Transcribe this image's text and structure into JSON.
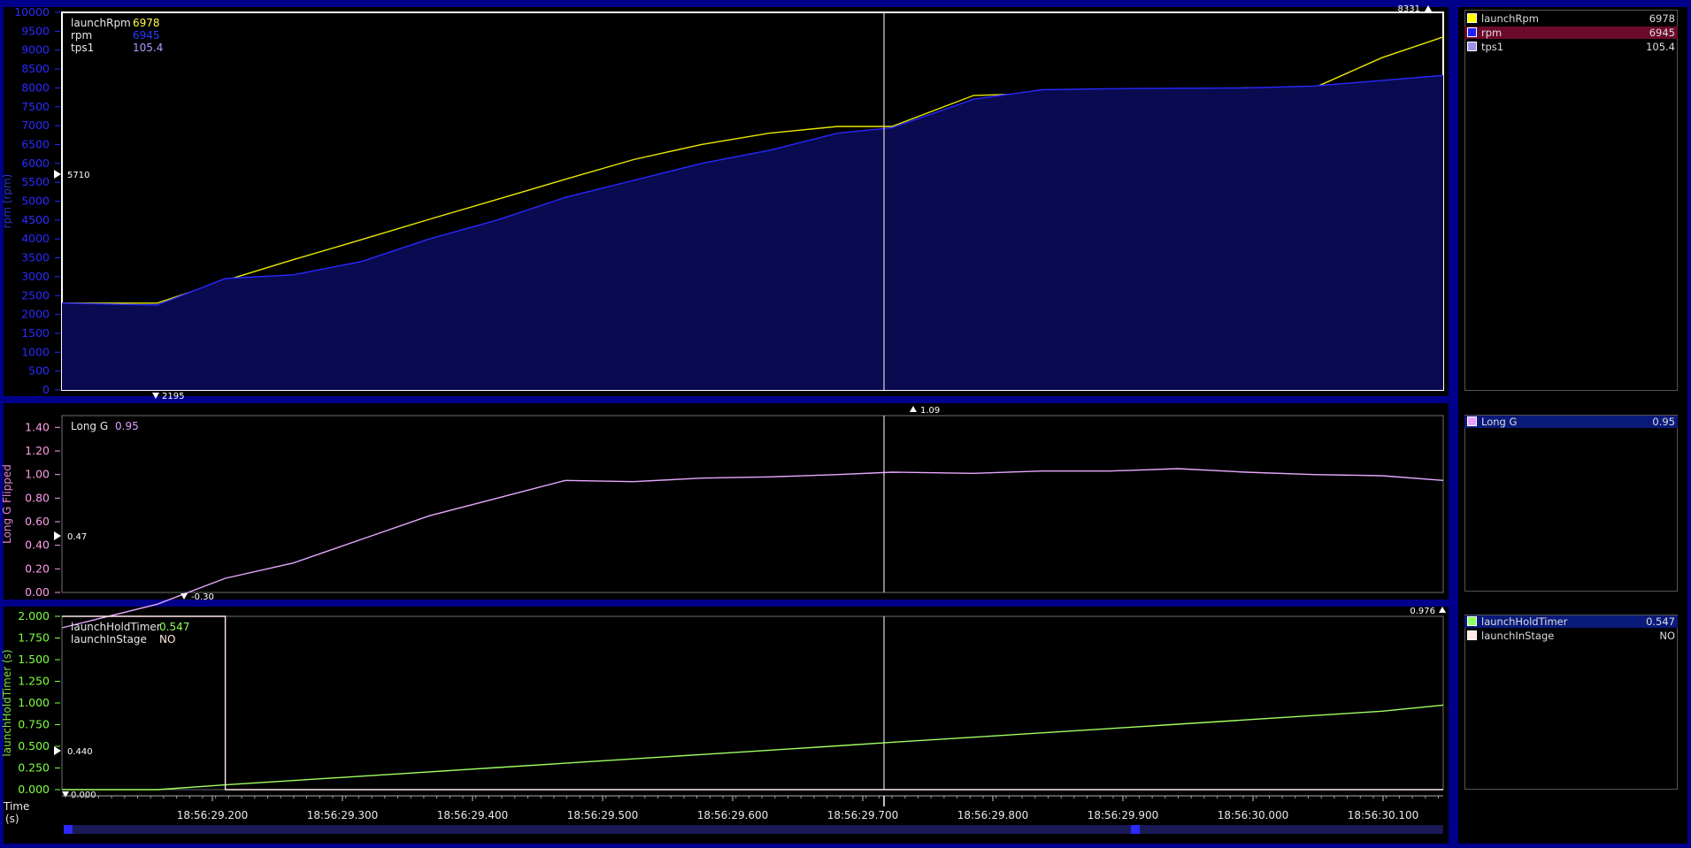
{
  "charts": [
    {
      "name": "rpm-chart",
      "y_axis_label": "rpm (rpm)",
      "ylim": [
        0,
        10000
      ],
      "y_ticks": [
        "0",
        "500",
        "1000",
        "1500",
        "2000",
        "2500",
        "3000",
        "3500",
        "4000",
        "4500",
        "5000",
        "5500",
        "6000",
        "6500",
        "7000",
        "7500",
        "8000",
        "8500",
        "9000",
        "9500",
        "10000"
      ],
      "markers": {
        "max": "8331",
        "min": "2195",
        "left": "5710"
      },
      "readout": [
        {
          "name": "launchRpm",
          "value": "6978",
          "color": "#ffff40"
        },
        {
          "name": "rpm",
          "value": "6945",
          "color": "#2a3aff"
        },
        {
          "name": "tps1",
          "value": "105.4",
          "color": "#a89cff"
        }
      ]
    },
    {
      "name": "long-g-chart",
      "y_axis_label": "Long G Flipped",
      "ylim": [
        0,
        1.5
      ],
      "y_ticks": [
        "0.00",
        "0.20",
        "0.40",
        "0.60",
        "0.80",
        "1.00",
        "1.20",
        "1.40"
      ],
      "markers": {
        "max": "1.09",
        "min": "-0.30",
        "left": "0.47"
      },
      "readout": [
        {
          "name": "Long G",
          "value": "0.95",
          "color": "#e0a0ff"
        }
      ]
    },
    {
      "name": "launch-timer-chart",
      "y_axis_label": "launchHoldTimer (s)",
      "ylim": [
        0,
        2
      ],
      "y_ticks": [
        "0.000",
        "0.250",
        "0.500",
        "0.750",
        "1.000",
        "1.250",
        "1.500",
        "1.750",
        "2.000"
      ],
      "markers": {
        "max": "0.976",
        "min": "0.000",
        "left": "0.440"
      },
      "readout": [
        {
          "name": "launchHoldTimer",
          "value": "0.547",
          "color": "#90ff60"
        },
        {
          "name": "launchInStage",
          "value": "NO",
          "color": "#ffe8e0"
        }
      ]
    }
  ],
  "time_axis": {
    "label_line1": "Time",
    "label_line2": "(s)",
    "ticks": [
      "18:56:29.200",
      "18:56:29.300",
      "18:56:29.400",
      "18:56:29.500",
      "18:56:29.600",
      "18:56:29.700",
      "18:56:29.800",
      "18:56:29.900",
      "18:56:30.000",
      "18:56:30.100"
    ]
  },
  "legend": {
    "panel1": [
      {
        "label": "launchRpm",
        "value": "6978",
        "color": "#ffff00"
      },
      {
        "label": "rpm",
        "value": "6945",
        "color": "#2020ff"
      },
      {
        "label": "tps1",
        "value": "105.4",
        "color": "#a090f0"
      }
    ],
    "panel2": [
      {
        "label": "Long G",
        "value": "0.95",
        "color": "#e8a0ff"
      }
    ],
    "panel3": [
      {
        "label": "launchHoldTimer",
        "value": "0.547",
        "color": "#90ff60"
      },
      {
        "label": "launchInStage",
        "value": "NO",
        "color": "#ffe8e8"
      }
    ]
  },
  "chart_data": [
    {
      "type": "line",
      "title": "",
      "xlabel": "Time (s)",
      "ylabel": "rpm (rpm)",
      "x": [
        29.13,
        29.2,
        29.25,
        29.3,
        29.35,
        29.4,
        29.45,
        29.5,
        29.55,
        29.6,
        29.65,
        29.7,
        29.74,
        29.8,
        29.85,
        29.9,
        29.95,
        30.0,
        30.05,
        30.1,
        30.145
      ],
      "series": [
        {
          "name": "launchRpm",
          "color": "#e8e800",
          "values": [
            2300,
            2300,
            2900,
            3450,
            3980,
            4520,
            5050,
            5580,
            6100,
            6500,
            6800,
            6978,
            6978,
            7800,
            7850,
            7900,
            7950,
            8000,
            8000,
            8800,
            9350
          ]
        },
        {
          "name": "rpm",
          "color": "#2828ff",
          "area": true,
          "values": [
            2300,
            2250,
            2950,
            3050,
            3400,
            4000,
            4500,
            5100,
            5550,
            6000,
            6350,
            6800,
            6945,
            7700,
            7950,
            7980,
            7990,
            8000,
            8050,
            8200,
            8331
          ]
        }
      ],
      "ylim": [
        0,
        10000
      ]
    },
    {
      "type": "line",
      "title": "",
      "xlabel": "Time (s)",
      "ylabel": "Long G Flipped",
      "x": [
        29.13,
        29.2,
        29.25,
        29.3,
        29.35,
        29.4,
        29.45,
        29.5,
        29.55,
        29.6,
        29.65,
        29.7,
        29.74,
        29.8,
        29.85,
        29.9,
        29.95,
        30.0,
        30.05,
        30.1,
        30.145
      ],
      "series": [
        {
          "name": "Long G",
          "color": "#e8a8ff",
          "values": [
            -0.3,
            -0.1,
            0.12,
            0.25,
            0.45,
            0.65,
            0.8,
            0.95,
            0.94,
            0.97,
            0.98,
            1.0,
            1.02,
            1.01,
            1.03,
            1.03,
            1.05,
            1.02,
            1.0,
            0.99,
            0.95
          ]
        }
      ],
      "ylim": [
        0,
        1.5
      ]
    },
    {
      "type": "line",
      "title": "",
      "xlabel": "Time (s)",
      "ylabel": "launchHoldTimer (s)",
      "x": [
        29.13,
        29.2,
        29.25,
        29.3,
        29.35,
        29.4,
        29.45,
        29.5,
        29.55,
        29.6,
        29.65,
        29.7,
        29.74,
        29.8,
        29.85,
        29.9,
        29.95,
        30.0,
        30.05,
        30.1,
        30.145
      ],
      "series": [
        {
          "name": "launchHoldTimer",
          "color": "#a0ff60",
          "values": [
            0.0,
            0.0,
            0.055,
            0.105,
            0.155,
            0.205,
            0.255,
            0.305,
            0.355,
            0.405,
            0.455,
            0.505,
            0.547,
            0.605,
            0.655,
            0.705,
            0.755,
            0.805,
            0.855,
            0.905,
            0.976
          ]
        },
        {
          "name": "launchInStage",
          "color": "#ffe8e8",
          "step": true,
          "values": [
            2.0,
            2.0,
            0,
            0,
            0,
            0,
            0,
            0,
            0,
            0,
            0,
            0,
            0,
            0,
            0,
            0,
            0,
            0,
            0,
            0,
            0
          ]
        }
      ],
      "ylim": [
        0,
        2
      ]
    }
  ]
}
